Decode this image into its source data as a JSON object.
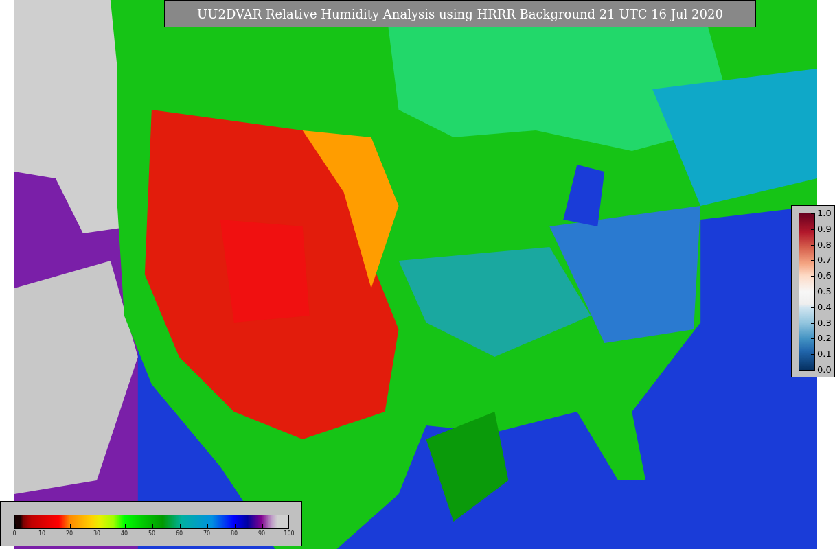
{
  "title": "UU2DVAR Relative Humidity Analysis using HRRR Background 21 UTC 16 Jul 2020",
  "humidity_colorbar": {
    "ticks": [
      "0",
      "10",
      "20",
      "30",
      "40",
      "50",
      "60",
      "70",
      "80",
      "90",
      "100"
    ]
  },
  "ratio_colorbar": {
    "ticks": [
      "1.0",
      "0.9",
      "0.8",
      "0.7",
      "0.6",
      "0.5",
      "0.4",
      "0.3",
      "0.2",
      "0.1",
      "0.0"
    ]
  }
}
